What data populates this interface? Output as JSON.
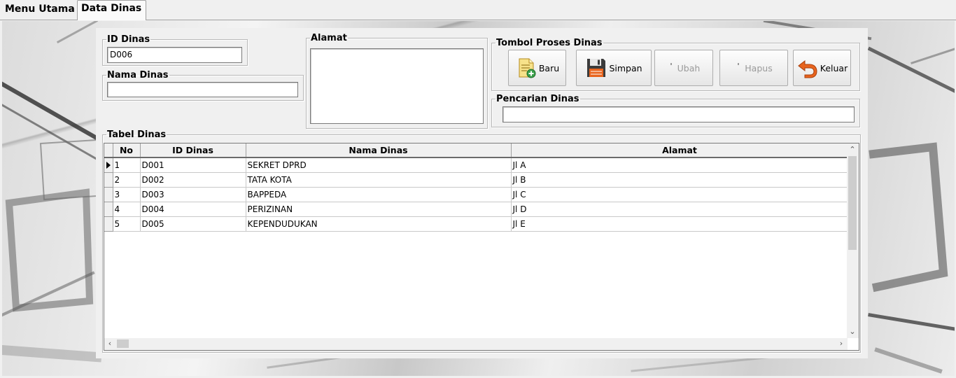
{
  "tabs": [
    {
      "label": "Menu Utama"
    },
    {
      "label": "Data Dinas"
    }
  ],
  "form": {
    "id_dinas": {
      "legend": "ID Dinas",
      "value": "D006"
    },
    "nama_dinas": {
      "legend": "Nama Dinas",
      "value": ""
    },
    "alamat": {
      "legend": "Alamat",
      "value": ""
    },
    "tombol": {
      "legend": "Tombol Proses Dinas",
      "buttons": [
        {
          "label": "Baru",
          "icon": "new-document-icon",
          "enabled": true
        },
        {
          "label": "Simpan",
          "icon": "floppy-disk-icon",
          "enabled": true
        },
        {
          "label": "Ubah",
          "icon": "edit-icon",
          "enabled": false
        },
        {
          "label": "Hapus",
          "icon": "delete-icon",
          "enabled": false
        },
        {
          "label": "Keluar",
          "icon": "exit-arrow-icon",
          "enabled": true
        }
      ]
    },
    "pencarian": {
      "legend": "Pencarian Dinas",
      "value": ""
    }
  },
  "table": {
    "legend": "Tabel Dinas",
    "columns": [
      "No",
      "ID Dinas",
      "Nama Dinas",
      "Alamat"
    ],
    "rows": [
      [
        "1",
        "D001",
        "SEKRET DPRD",
        "Jl A"
      ],
      [
        "2",
        "D002",
        "TATA KOTA",
        "Jl B"
      ],
      [
        "3",
        "D003",
        "BAPPEDA",
        "Jl C"
      ],
      [
        "4",
        "D004",
        "PERIZINAN",
        "Jl D"
      ],
      [
        "5",
        "D005",
        "KEPENDUDUKAN",
        "Jl E"
      ]
    ],
    "selected_row": 0
  },
  "colors": {
    "window_bg": "#f0f0f0",
    "orange_accent": "#e8641e",
    "disabled_text": "#9a9a9a"
  }
}
